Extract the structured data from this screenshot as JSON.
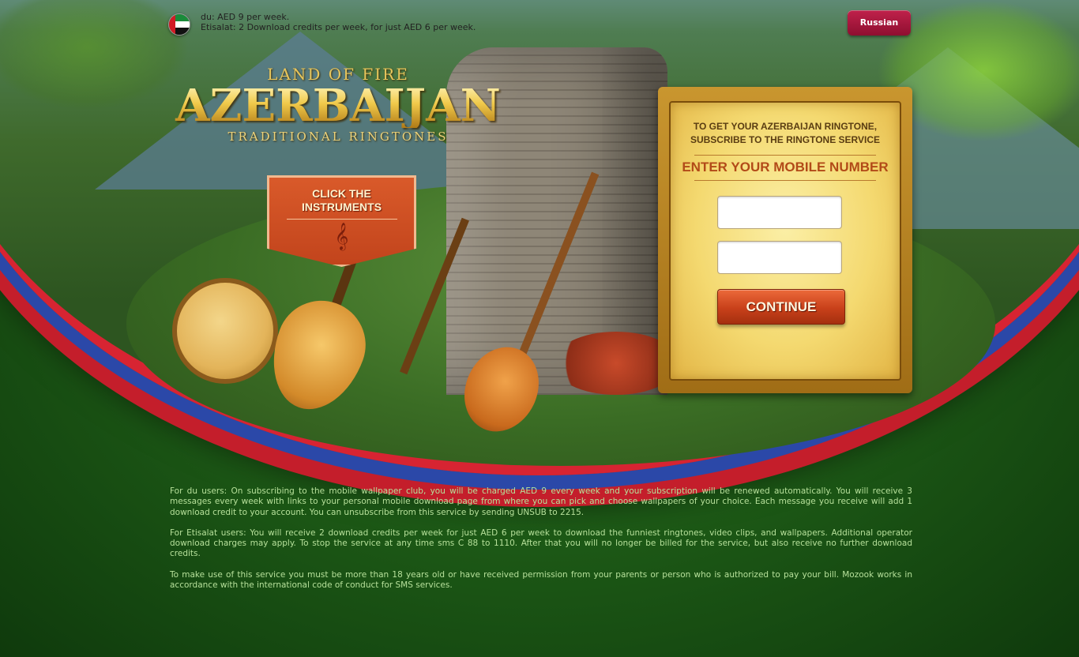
{
  "top_info": {
    "line1": "du: AED 9 per week.",
    "line2": "Etisalat: 2 Download credits per week, for just AED 6 per week."
  },
  "language_button": "Russian",
  "logo": {
    "sub1": "LAND OF FIRE",
    "main": "AZERBAIJAN",
    "sub2": "TRADITIONAL RINGTONES"
  },
  "banner": {
    "label": "CLICK THE INSTRUMENTS",
    "icon": "treble-clef-icon",
    "glyph": "𝄞"
  },
  "subscribe": {
    "intro_line1": "TO GET YOUR AZERBAIJAN RINGTONE,",
    "intro_line2": "SUBSCRIBE TO THE RINGTONE SERVICE",
    "heading": "ENTER YOUR MOBILE NUMBER",
    "field1_value": "",
    "field2_value": "",
    "continue_label": "CONTINUE"
  },
  "terms": [
    "For du users: On subscribing to the mobile wallpaper club, you will be charged AED 9 every week and your subscription will be renewed automatically. You will receive 3 messages every week with links to your personal mobile download page from where you can pick and choose wallpapers of your choice. Each message you receive will add 1 download credit to your account. You can unsubscribe from this service by sending UNSUB to 2215.",
    "For Etisalat users: You will receive 2 download credits per week for just AED 6 per week to download the funniest ringtones, video clips, and wallpapers. Additional operator download charges may apply. To stop the service at any time sms C 88 to 1110. After that you will no longer be billed for the service, but also receive no further download credits.",
    "To make use of this service you must be more than 18 years old or have received permission from your parents or person who is authorized to pay your bill. Mozook works in accordance with the international code of conduct for SMS services."
  ],
  "colors": {
    "accent_red": "#c41e2b",
    "accent_blue": "#2b48a8",
    "background_green": "#1e5c17",
    "gold": "#f0c94a"
  }
}
